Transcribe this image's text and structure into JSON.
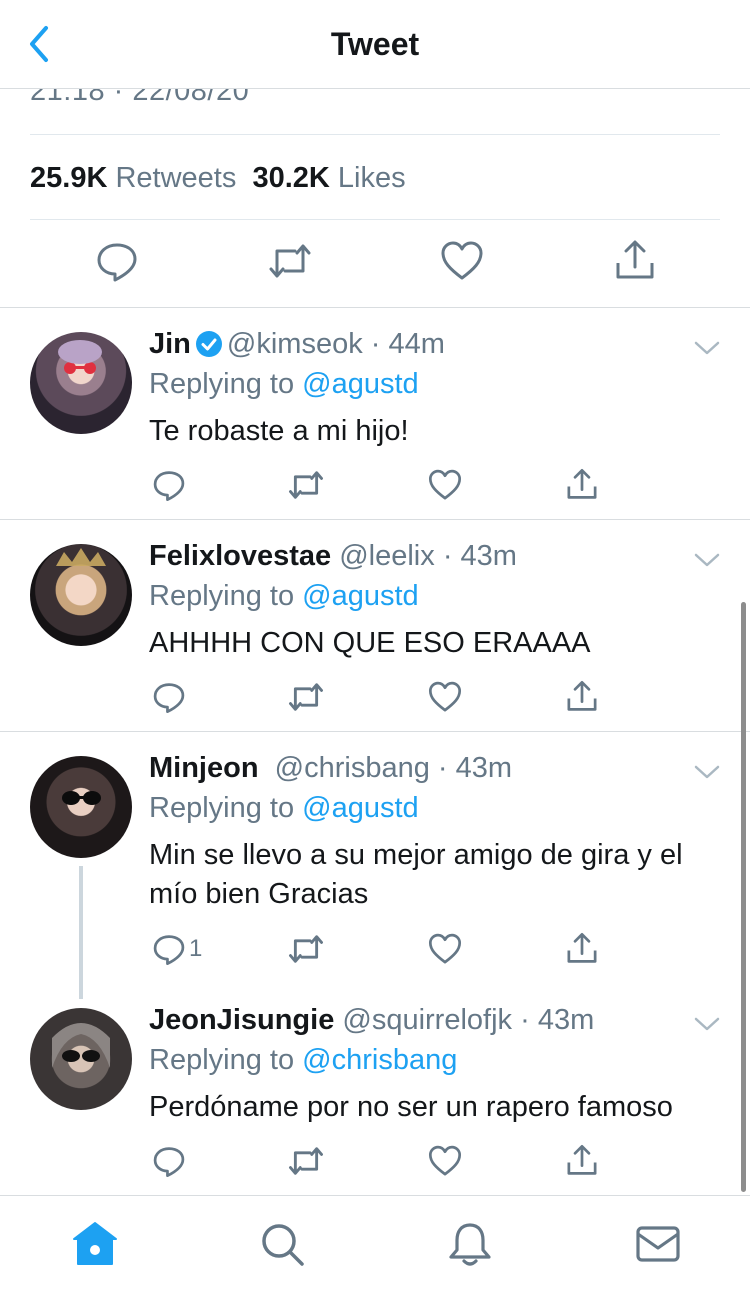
{
  "header": {
    "title": "Tweet",
    "back_icon": "chevron-left-icon"
  },
  "tweet": {
    "timestamp": "21:18 · 22/08/20",
    "retweets_count": "25.9K",
    "retweets_label": "Retweets",
    "likes_count": "30.2K",
    "likes_label": "Likes"
  },
  "replies": [
    {
      "name": "Jin",
      "verified": true,
      "handle": "@kimseok",
      "time": "· 44m",
      "replying_prefix": "Replying to",
      "replying_to": "@agustd",
      "text": "Te robaste a mi hijo!",
      "reply_count": ""
    },
    {
      "name": "Felixlovestae",
      "verified": false,
      "handle": "@leelix",
      "time": "· 43m",
      "replying_prefix": "Replying to",
      "replying_to": "@agustd",
      "text": "AHHHH CON QUE ESO ERAAAA",
      "reply_count": ""
    },
    {
      "name": "Minjeon",
      "verified": false,
      "handle": "@chrisbang",
      "time": "· 43m",
      "replying_prefix": "Replying to",
      "replying_to": "@agustd",
      "text": "Min se llevo a su mejor amigo de gira y el mío bien Gracias",
      "reply_count": "1"
    },
    {
      "name": "JeonJisungie",
      "verified": false,
      "handle": "@squirrelofjk",
      "time": "· 43m",
      "replying_prefix": "Replying to",
      "replying_to": "@chrisbang",
      "text": "Perdóname por no ser un rapero famoso",
      "reply_count": ""
    }
  ],
  "tabs": [
    "home-icon",
    "search-icon",
    "bell-icon",
    "mail-icon"
  ],
  "colors": {
    "accent": "#1da1f2",
    "text": "#14171a",
    "secondary": "#657786",
    "divider": "#e1e8ed"
  }
}
